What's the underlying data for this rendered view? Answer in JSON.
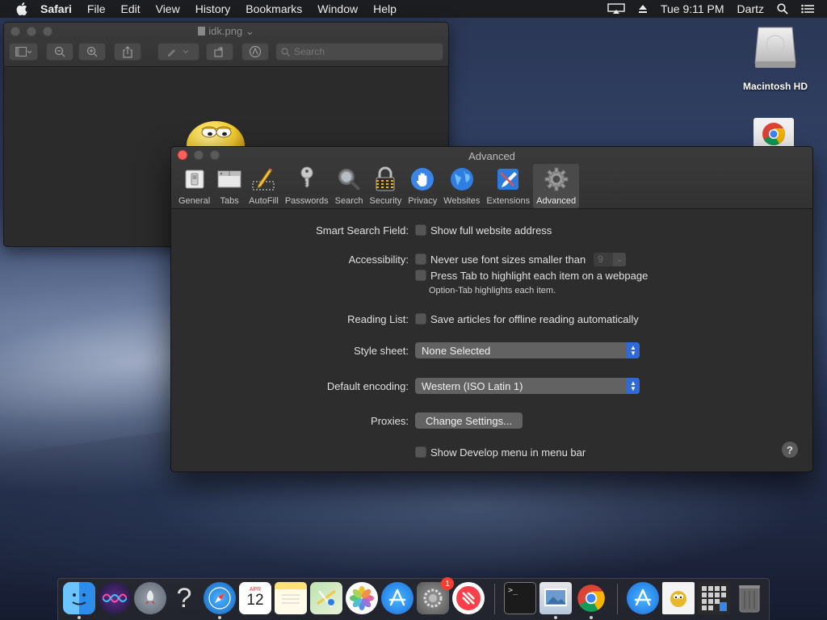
{
  "menubar": {
    "app": "Safari",
    "items": [
      "File",
      "Edit",
      "View",
      "History",
      "Bookmarks",
      "Window",
      "Help"
    ],
    "clock": "Tue 9:11 PM",
    "user": "Dartz"
  },
  "desktop": {
    "icons": [
      {
        "label": "Macintosh HD",
        "icon": "hard-drive-icon"
      },
      {
        "label": "",
        "icon": "chrome-icon"
      }
    ]
  },
  "preview_window": {
    "title": "idk.png",
    "search_placeholder": "Search"
  },
  "prefs_window": {
    "title": "Advanced",
    "tabs": [
      {
        "label": "General",
        "icon": "general-switch-icon"
      },
      {
        "label": "Tabs",
        "icon": "tabs-icon"
      },
      {
        "label": "AutoFill",
        "icon": "autofill-pencil-icon"
      },
      {
        "label": "Passwords",
        "icon": "key-icon"
      },
      {
        "label": "Search",
        "icon": "magnifier-icon"
      },
      {
        "label": "Security",
        "icon": "padlock-icon"
      },
      {
        "label": "Privacy",
        "icon": "hand-icon"
      },
      {
        "label": "Websites",
        "icon": "globe-icon"
      },
      {
        "label": "Extensions",
        "icon": "puzzle-icon"
      },
      {
        "label": "Advanced",
        "icon": "gear-icon",
        "active": true
      }
    ],
    "settings": {
      "smart_search_label": "Smart Search Field:",
      "show_full_address": "Show full website address",
      "accessibility_label": "Accessibility:",
      "never_font_smaller": "Never use font sizes smaller than",
      "min_font_size": "9",
      "press_tab": "Press Tab to highlight each item on a webpage",
      "option_tab_note": "Option-Tab highlights each item.",
      "reading_list_label": "Reading List:",
      "save_articles": "Save articles for offline reading automatically",
      "style_sheet_label": "Style sheet:",
      "style_sheet_value": "None Selected",
      "encoding_label": "Default encoding:",
      "encoding_value": "Western (ISO Latin 1)",
      "proxies_label": "Proxies:",
      "proxies_button": "Change Settings...",
      "develop_menu": "Show Develop menu in menu bar",
      "help": "?"
    }
  },
  "dock": {
    "items": [
      "finder-icon",
      "siri-icon",
      "launchpad-icon",
      "question-icon",
      "safari-icon",
      "calendar-icon",
      "notes-icon",
      "maps-icon",
      "photos-icon",
      "app-store-icon",
      "system-preferences-icon",
      "news-icon",
      "terminal-icon",
      "preview-icon",
      "chrome-icon",
      "app-store-folder-icon",
      "preview-doc-icon",
      "screenshots-stack-icon",
      "trash-icon"
    ],
    "calendar_month": "APR",
    "calendar_day": "12",
    "badge": "1"
  }
}
